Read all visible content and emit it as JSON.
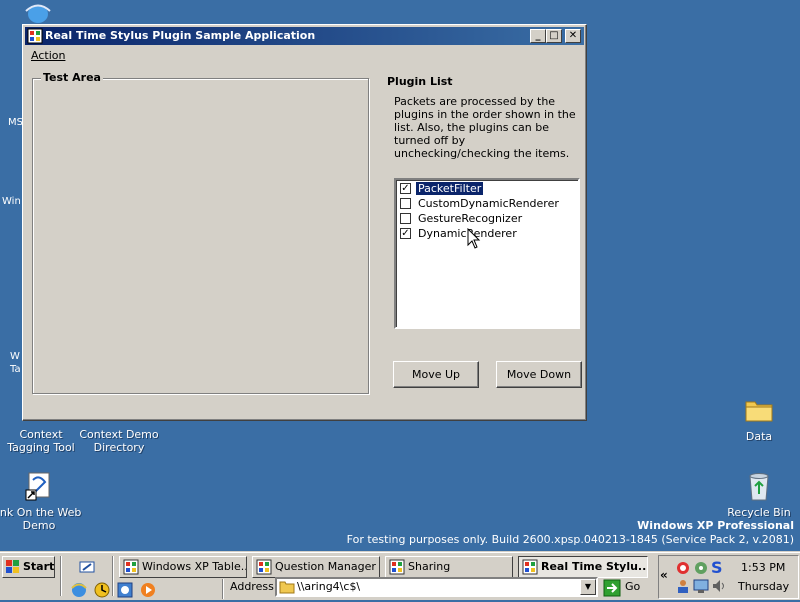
{
  "desktop": {
    "icons": [
      {
        "label": "Context Tagging Tool"
      },
      {
        "label": "Context Demo Directory"
      },
      {
        "label": "Ink On the Web Demo"
      },
      {
        "label": "Data"
      },
      {
        "label": "Recycle Bin"
      }
    ],
    "partial_labels": [
      "MS",
      "Win",
      "W",
      "Ta"
    ],
    "watermark_edition": "Windows XP Professional",
    "watermark_build": "For testing purposes only. Build 2600.xpsp.040213-1845 (Service Pack 2, v.2081)"
  },
  "window": {
    "title": "Real Time Stylus Plugin Sample Application",
    "menu": {
      "action": "Action"
    },
    "test_area_label": "Test Area",
    "plugin_title": "Plugin List",
    "plugin_description": "Packets are processed by the plugins in the order shown in the list.  Also, the plugins can be turned off by unchecking/checking the items.",
    "plugins": [
      {
        "name": "PacketFilter",
        "checked": true,
        "selected": true
      },
      {
        "name": "CustomDynamicRenderer",
        "checked": false,
        "selected": false
      },
      {
        "name": "GestureRecognizer",
        "checked": false,
        "selected": false
      },
      {
        "name": "DynamicRenderer",
        "checked": true,
        "selected": false
      }
    ],
    "move_up_label": "Move Up",
    "move_down_label": "Move Down"
  },
  "taskbar": {
    "start_label": "Start",
    "tasks": [
      {
        "label": "Windows XP Table..."
      },
      {
        "label": "Question Manager"
      },
      {
        "label": "Sharing"
      },
      {
        "label": "Real Time Stylu..."
      }
    ],
    "address_label": "Address",
    "address_value": "\\\\aring4\\c$\\",
    "go_label": "Go",
    "clock_time": "1:53 PM",
    "clock_day": "Thursday"
  },
  "colors": {
    "desktop": "#3a6ea5",
    "title_active": "#0a246a",
    "face": "#d4d0c8"
  }
}
